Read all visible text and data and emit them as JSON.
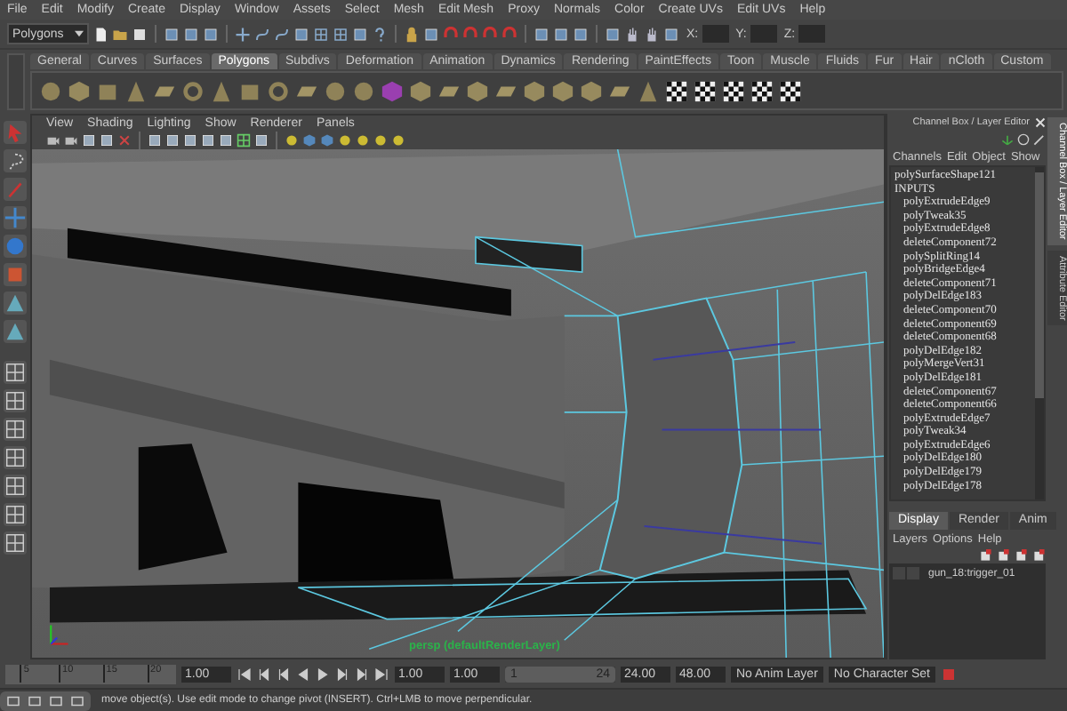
{
  "menu_bar": [
    "File",
    "Edit",
    "Modify",
    "Create",
    "Display",
    "Window",
    "Assets",
    "Select",
    "Mesh",
    "Edit Mesh",
    "Proxy",
    "Normals",
    "Color",
    "Create UVs",
    "Edit UVs",
    "Help"
  ],
  "status_line": {
    "mode": "Polygons",
    "xyz_labels": [
      "X:",
      "Y:",
      "Z:"
    ]
  },
  "shelf": {
    "tabs": [
      {
        "label": "General",
        "selected": false
      },
      {
        "label": "Curves",
        "selected": false
      },
      {
        "label": "Surfaces",
        "selected": false
      },
      {
        "label": "Polygons",
        "selected": true
      },
      {
        "label": "Subdivs",
        "selected": false
      },
      {
        "label": "Deformation",
        "selected": false
      },
      {
        "label": "Animation",
        "selected": false
      },
      {
        "label": "Dynamics",
        "selected": false
      },
      {
        "label": "Rendering",
        "selected": false
      },
      {
        "label": "PaintEffects",
        "selected": false
      },
      {
        "label": "Toon",
        "selected": false
      },
      {
        "label": "Muscle",
        "selected": false
      },
      {
        "label": "Fluids",
        "selected": false
      },
      {
        "label": "Fur",
        "selected": false
      },
      {
        "label": "Hair",
        "selected": false
      },
      {
        "label": "nCloth",
        "selected": false
      },
      {
        "label": "Custom",
        "selected": false
      }
    ]
  },
  "viewport": {
    "menu": [
      "View",
      "Shading",
      "Lighting",
      "Show",
      "Renderer",
      "Panels"
    ],
    "camera_label": "persp (defaultRenderLayer)"
  },
  "channel_box": {
    "title": "Channel Box / Layer Editor",
    "menu": [
      "Channels",
      "Edit",
      "Object",
      "Show"
    ],
    "items": [
      {
        "kind": "shape",
        "text": "polySurfaceShape121"
      },
      {
        "kind": "header",
        "text": "INPUTS"
      },
      {
        "kind": "node",
        "text": "polyExtrudeEdge9"
      },
      {
        "kind": "node",
        "text": "polyTweak35"
      },
      {
        "kind": "node",
        "text": "polyExtrudeEdge8"
      },
      {
        "kind": "node",
        "text": "deleteComponent72"
      },
      {
        "kind": "node",
        "text": "polySplitRing14"
      },
      {
        "kind": "node",
        "text": "polyBridgeEdge4"
      },
      {
        "kind": "node",
        "text": "deleteComponent71"
      },
      {
        "kind": "node",
        "text": "polyDelEdge183"
      },
      {
        "kind": "node",
        "text": "deleteComponent70"
      },
      {
        "kind": "node",
        "text": "deleteComponent69"
      },
      {
        "kind": "node",
        "text": "deleteComponent68"
      },
      {
        "kind": "node",
        "text": "polyDelEdge182"
      },
      {
        "kind": "node",
        "text": "polyMergeVert31"
      },
      {
        "kind": "node",
        "text": "polyDelEdge181"
      },
      {
        "kind": "node",
        "text": "deleteComponent67"
      },
      {
        "kind": "node",
        "text": "deleteComponent66"
      },
      {
        "kind": "node",
        "text": "polyExtrudeEdge7"
      },
      {
        "kind": "node",
        "text": "polyTweak34"
      },
      {
        "kind": "node",
        "text": "polyExtrudeEdge6"
      },
      {
        "kind": "node",
        "text": "polyDelEdge180"
      },
      {
        "kind": "node",
        "text": "polyDelEdge179"
      },
      {
        "kind": "node",
        "text": "polyDelEdge178"
      }
    ]
  },
  "layer_editor": {
    "tabs": [
      {
        "label": "Display",
        "selected": true
      },
      {
        "label": "Render",
        "selected": false
      },
      {
        "label": "Anim",
        "selected": false
      }
    ],
    "menu": [
      "Layers",
      "Options",
      "Help"
    ],
    "layers": [
      {
        "name": "gun_18:trigger_01"
      }
    ]
  },
  "side_tabs": [
    {
      "label": "Channel Box / Layer Editor",
      "selected": true
    },
    {
      "label": "Attribute Editor",
      "selected": false
    }
  ],
  "time_slider": {
    "ticks": [
      "5",
      "10",
      "15",
      "20"
    ],
    "current_time": "1.00",
    "start_fields": [
      "1.00",
      "1.00"
    ],
    "range_start": "1",
    "range_end": "24",
    "level": 1,
    "end_fields": [
      "24.00",
      "48.00"
    ],
    "anim_layer": "No Anim Layer",
    "character_set": "No Character Set"
  },
  "help_line": "move object(s). Use edit mode to change pivot (INSERT).  Ctrl+LMB to move perpendicular."
}
